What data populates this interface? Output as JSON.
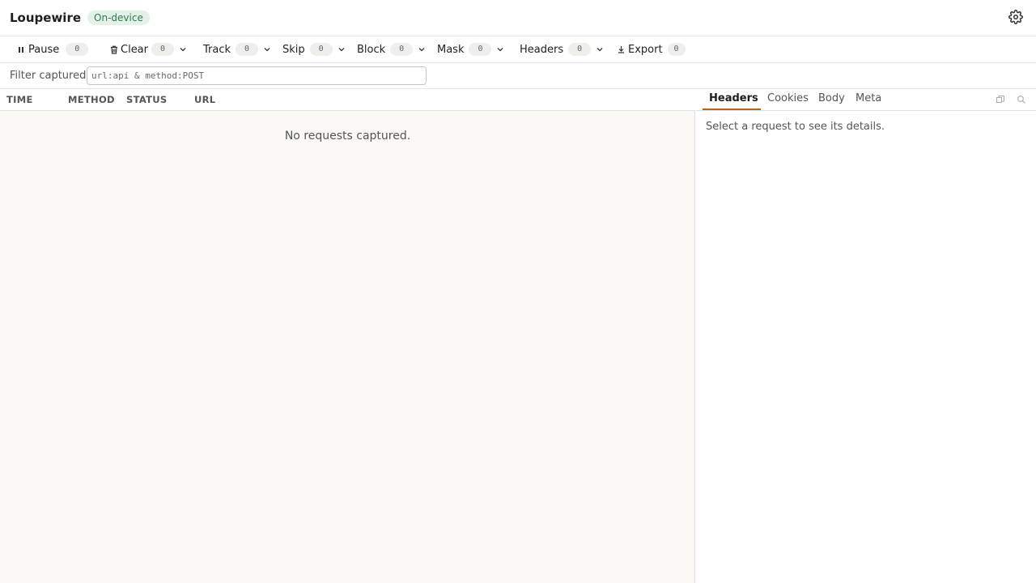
{
  "app": {
    "title": "Loupewire",
    "badge": "On-device",
    "settings_icon": "gear-icon"
  },
  "toolbar": {
    "pause": {
      "label": "Pause",
      "count": "0",
      "icon": "pause-icon"
    },
    "clear": {
      "label": "Clear",
      "count": "0",
      "icon": "trash-icon"
    },
    "track": {
      "label": "Track",
      "count": "0"
    },
    "skip": {
      "label": "Skip",
      "count": "0"
    },
    "block": {
      "label": "Block",
      "count": "0"
    },
    "mask": {
      "label": "Mask",
      "count": "0"
    },
    "headers": {
      "label": "Headers",
      "count": "0"
    },
    "export": {
      "label": "Export",
      "count": "0",
      "icon": "download-icon"
    }
  },
  "filter": {
    "label": "Filter captured",
    "value": "",
    "placeholder": "url:api & method:POST"
  },
  "table": {
    "columns": [
      "TIME",
      "METHOD",
      "STATUS",
      "URL"
    ],
    "rows": [],
    "empty_message": "No requests captured."
  },
  "details": {
    "tabs": [
      "Headers",
      "Cookies",
      "Body",
      "Meta"
    ],
    "active_tab": "Headers",
    "empty_message": "Select a request to see its details."
  },
  "colors": {
    "badge_bg": "#e3f1e8",
    "badge_text": "#2e7b4f",
    "active_tab_underline": "#b5651d",
    "list_background": "#faf9f6"
  }
}
